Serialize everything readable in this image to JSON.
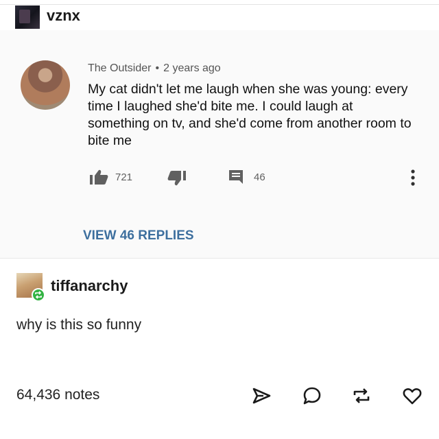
{
  "header": {
    "username": "vznx",
    "avatar_icon": "user-avatar"
  },
  "comment": {
    "author": "The Outsider",
    "separator": "•",
    "time": "2 years ago",
    "text": "My cat didn't let me laugh when she was young: every time I laughed she'd bite me. I could laugh at something on tv, and she'd come from another room to bite me",
    "likes": "721",
    "replies_count": "46",
    "view_replies": "VIEW 46 REPLIES"
  },
  "reblog": {
    "username": "tiffanarchy",
    "text": "why is this so funny",
    "badge_color": "#33b343"
  },
  "footer": {
    "notes": "64,436 notes",
    "icons": [
      "share-icon",
      "comment-icon",
      "reblog-icon",
      "heart-icon"
    ]
  },
  "colors": {
    "link_blue": "#3d6f9e",
    "icon_gray": "#606060"
  }
}
